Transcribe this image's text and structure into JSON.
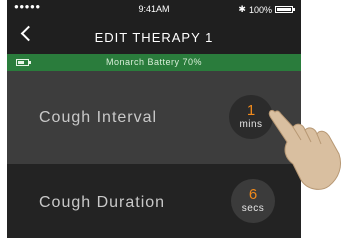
{
  "status_bar": {
    "signal": "●●●●●",
    "time": "9:41AM",
    "battery_percent": "100%",
    "bluetooth_icon": "bluetooth-icon",
    "battery_level": 1.0
  },
  "nav": {
    "back_icon": "chevron-left-icon",
    "title": "EDIT THERAPY 1"
  },
  "battery_banner": {
    "text": "Monarch Battery 70%",
    "icon": "battery-icon",
    "level": 0.7,
    "color": "#2a7c3c"
  },
  "settings": [
    {
      "label": "Cough Interval",
      "value": "1",
      "unit": "mins"
    },
    {
      "label": "Cough Duration",
      "value": "6",
      "unit": "secs"
    }
  ],
  "colors": {
    "value_accent": "#f08a1c",
    "background": "#1f1f1f",
    "selected_row": "#3d3d3d"
  },
  "overlay": {
    "icon": "pointing-hand-icon"
  }
}
